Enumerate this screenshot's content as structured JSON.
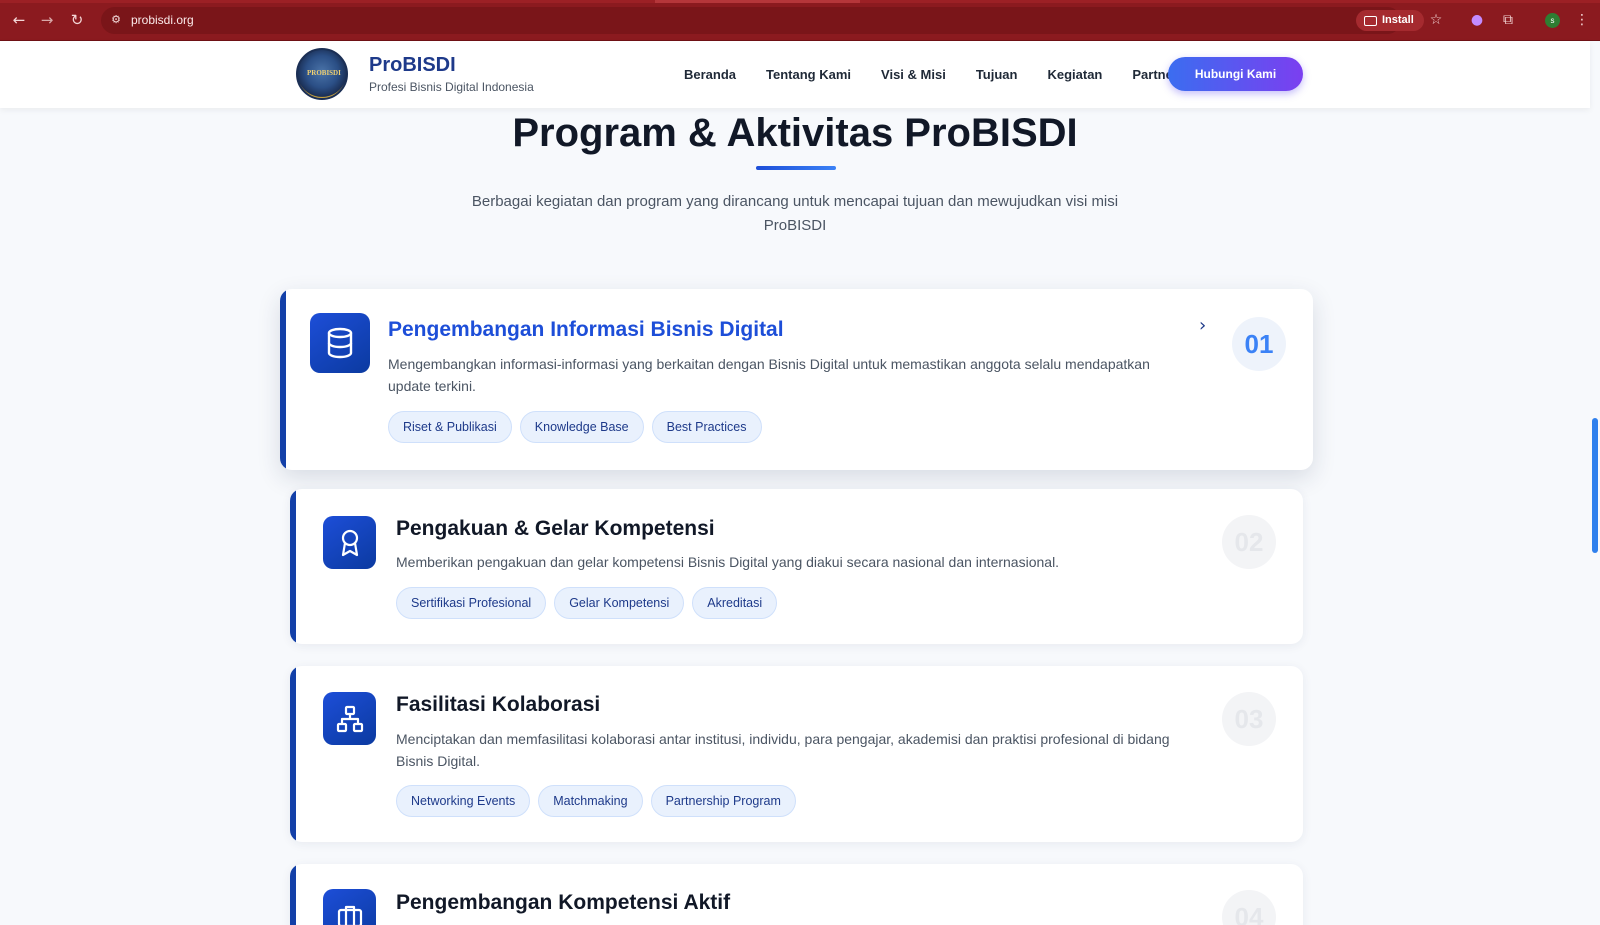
{
  "browser": {
    "url": "probisdi.org",
    "install_label": "Install",
    "profile_initial": "s"
  },
  "header": {
    "brand_name": "ProBISDI",
    "brand_subtitle": "Profesi Bisnis Digital Indonesia",
    "logo_text": "PROBISDI",
    "nav": [
      "Beranda",
      "Tentang Kami",
      "Visi & Misi",
      "Tujuan",
      "Kegiatan",
      "Partners"
    ],
    "cta_label": "Hubungi Kami"
  },
  "section": {
    "title": "Program & Aktivitas ProBISDI",
    "subtitle": "Berbagai kegiatan dan program yang dirancang untuk mencapai tujuan dan mewujudkan visi misi ProBISDI"
  },
  "programs": [
    {
      "number": "01",
      "title": "Pengembangan Informasi Bisnis Digital",
      "description": "Mengembangkan informasi-informasi yang berkaitan dengan Bisnis Digital untuk memastikan anggota selalu mendapatkan update terkini.",
      "tags": [
        "Riset & Publikasi",
        "Knowledge Base",
        "Best Practices"
      ],
      "icon": "database-icon"
    },
    {
      "number": "02",
      "title": "Pengakuan & Gelar Kompetensi",
      "description": "Memberikan pengakuan dan gelar kompetensi Bisnis Digital yang diakui secara nasional dan internasional.",
      "tags": [
        "Sertifikasi Profesional",
        "Gelar Kompetensi",
        "Akreditasi"
      ],
      "icon": "award-icon"
    },
    {
      "number": "03",
      "title": "Fasilitasi Kolaborasi",
      "description": "Menciptakan dan memfasilitasi kolaborasi antar institusi, individu, para pengajar, akademisi dan praktisi profesional di bidang Bisnis Digital.",
      "tags": [
        "Networking Events",
        "Matchmaking",
        "Partnership Program"
      ],
      "icon": "network-icon"
    },
    {
      "number": "04",
      "title": "Pengembangan Kompetensi Aktif",
      "icon": "briefcase-icon"
    }
  ],
  "colors": {
    "browser_frame": "#8b1a1f",
    "brand_blue": "#1d4ed8",
    "accent_bar": "#1340a8",
    "cta_gradient_start": "#3b6df0",
    "cta_gradient_end": "#7b3ff0"
  }
}
